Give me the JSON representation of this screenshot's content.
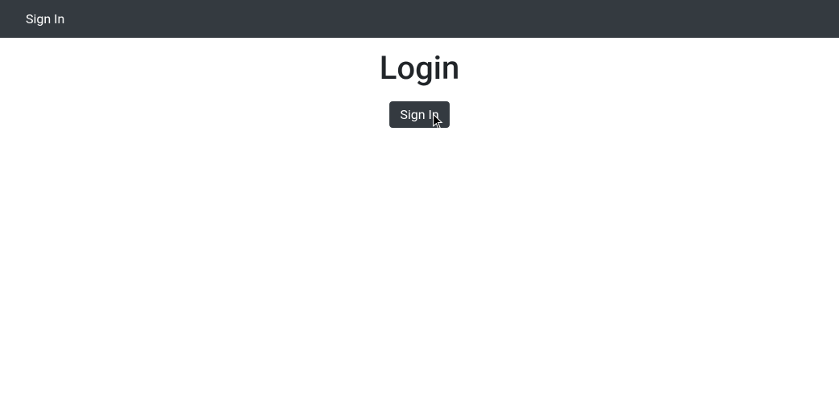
{
  "navbar": {
    "signin_link": "Sign In"
  },
  "main": {
    "title": "Login",
    "signin_button": "Sign In"
  }
}
